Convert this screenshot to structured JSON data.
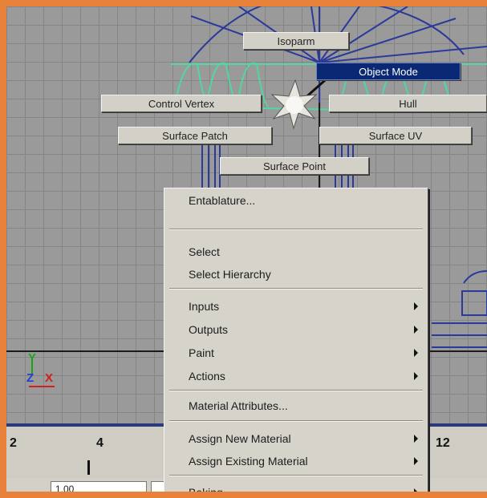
{
  "marking_menu": {
    "isoparm": "Isoparm",
    "object_mode": "Object Mode",
    "control_vertex": "Control Vertex",
    "hull": "Hull",
    "surface_patch": "Surface Patch",
    "surface_uv": "Surface UV",
    "surface_point": "Surface Point"
  },
  "context_menu": {
    "entablature": "Entablature...",
    "select": "Select",
    "select_hierarchy": "Select Hierarchy",
    "inputs": "Inputs",
    "outputs": "Outputs",
    "paint": "Paint",
    "actions": "Actions",
    "material_attributes": "Material Attributes...",
    "assign_new_material": "Assign New Material",
    "assign_existing_material": "Assign Existing Material",
    "baking": "Baking"
  },
  "axis_indicator": {
    "y": "Y",
    "z": "Z",
    "x": "X",
    "y_color": "#1aa31a",
    "z_color": "#2040d0",
    "x_color": "#d02020"
  },
  "timeline": {
    "ticks": [
      "2",
      "4",
      "12"
    ]
  },
  "range": {
    "start_value": "1.00"
  },
  "colors": {
    "frame": "#e8823a",
    "active_item": "#0a2874",
    "wireframe": "#2b3a9a",
    "selection_highlight": "#50d8a0"
  }
}
